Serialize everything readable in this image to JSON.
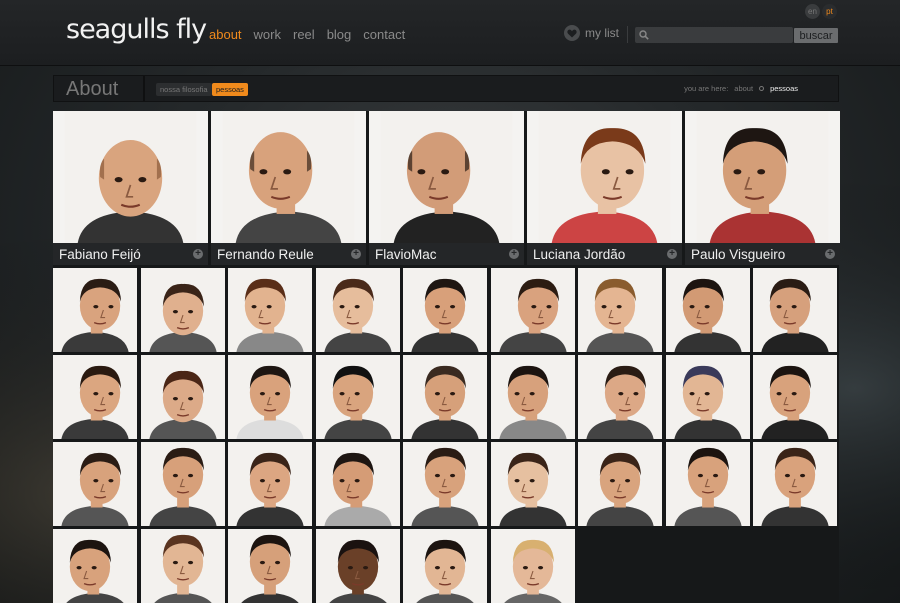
{
  "brand": {
    "logo": "seagulls fly"
  },
  "nav": {
    "items": [
      "about",
      "work",
      "reel",
      "blog",
      "contact"
    ],
    "active": "about"
  },
  "mylist": {
    "label": "my list",
    "icon": "heart-icon"
  },
  "search": {
    "placeholder": "",
    "button_label": "buscar"
  },
  "languages": {
    "en": "en",
    "pt": "pt",
    "active": "pt"
  },
  "about": {
    "title": "About",
    "subtabs": [
      "nossa filosofia",
      "pessoas"
    ],
    "active_subtab": "pessoas",
    "breadcrumb": {
      "prefix": "you are here:",
      "items": [
        "about",
        "pessoas"
      ]
    }
  },
  "featured": [
    {
      "name": "Fabiano Feijó"
    },
    {
      "name": "Fernando Reule"
    },
    {
      "name": "FlavioMac"
    },
    {
      "name": "Luciana Jordão"
    },
    {
      "name": "Paulo Visgueiro"
    }
  ],
  "thumbnails": [
    {
      "skin": "#d9a37e",
      "hair": "#2a1c14",
      "shirt": "#3a3a3a",
      "pose": "right"
    },
    {
      "skin": "#e0b08e",
      "hair": "#3a2418",
      "shirt": "#555",
      "pose": "down"
    },
    {
      "skin": "#e2b38f",
      "hair": "#5a2e18",
      "shirt": "#888",
      "pose": "left"
    },
    {
      "skin": "#e6bd9c",
      "hair": "#4a2a1a",
      "shirt": "#444",
      "pose": "left"
    },
    {
      "skin": "#d8a07a",
      "hair": "#1e1612",
      "shirt": "#333",
      "pose": "front"
    },
    {
      "skin": "#d9a27e",
      "hair": "#2c1c12",
      "shirt": "#444",
      "pose": "right"
    },
    {
      "skin": "#e4b592",
      "hair": "#8a5c2e",
      "shirt": "#555",
      "pose": "left"
    },
    {
      "skin": "#d29a74",
      "hair": "#1c1410",
      "shirt": "#333",
      "pose": "left"
    },
    {
      "skin": "#d6a07c",
      "hair": "#2a1c14",
      "shirt": "#222",
      "pose": "left"
    },
    {
      "skin": "#dba680",
      "hair": "#2a1a10",
      "shirt": "#3a3a3a",
      "pose": "right"
    },
    {
      "skin": "#dcaa88",
      "hair": "#4a2616",
      "shirt": "#555",
      "pose": "down"
    },
    {
      "skin": "#d9a27c",
      "hair": "#1e1612",
      "shirt": "#ddd",
      "pose": "front"
    },
    {
      "skin": "#d9a47e",
      "hair": "#111111",
      "shirt": "#444",
      "pose": "left"
    },
    {
      "skin": "#d6a07a",
      "hair": "#3a2a20",
      "shirt": "#333",
      "pose": "front"
    },
    {
      "skin": "#d7a17c",
      "hair": "#1c1410",
      "shirt": "#888",
      "pose": "left"
    },
    {
      "skin": "#dca886",
      "hair": "#2a1c14",
      "shirt": "#444",
      "pose": "right"
    },
    {
      "skin": "#e2b694",
      "hair": "#3a3a5a",
      "shirt": "#333",
      "pose": "left"
    },
    {
      "skin": "#d8a27c",
      "hair": "#1c1410",
      "shirt": "#222",
      "pose": "left"
    },
    {
      "skin": "#d8a27c",
      "hair": "#2a1c14",
      "shirt": "#555",
      "pose": "right"
    },
    {
      "skin": "#d7a07a",
      "hair": "#2a1c14",
      "shirt": "#444",
      "pose": "up"
    },
    {
      "skin": "#dca682",
      "hair": "#3a2418",
      "shirt": "#333",
      "pose": "front"
    },
    {
      "skin": "#d59c76",
      "hair": "#1e1612",
      "shirt": "#aaa",
      "pose": "left"
    },
    {
      "skin": "#d8a27c",
      "hair": "#2a1c14",
      "shirt": "#555",
      "pose": "up"
    },
    {
      "skin": "#e6c0a0",
      "hair": "#3a2418",
      "shirt": "#333",
      "pose": "left"
    },
    {
      "skin": "#d9a47e",
      "hair": "#3a2418",
      "shirt": "#444",
      "pose": "front"
    },
    {
      "skin": "#d8a27c",
      "hair": "#1c1410",
      "shirt": "#555",
      "pose": "up"
    },
    {
      "skin": "#d9a27c",
      "hair": "#3a2418",
      "shirt": "#333",
      "pose": "up"
    },
    {
      "skin": "#d8a27c",
      "hair": "#1c1410",
      "shirt": "#444",
      "pose": "left"
    },
    {
      "skin": "#e2b694",
      "hair": "#5a3420",
      "shirt": "#555",
      "pose": "up"
    },
    {
      "skin": "#d6a07a",
      "hair": "#1c1410",
      "shirt": "#333",
      "pose": "up"
    },
    {
      "skin": "#6a4028",
      "hair": "#1a1210",
      "shirt": "#444",
      "pose": "front"
    },
    {
      "skin": "#e2b694",
      "hair": "#1c1410",
      "shirt": "#555",
      "pose": "front"
    },
    {
      "skin": "#e4b898",
      "hair": "#d8b070",
      "shirt": "#666",
      "pose": "front"
    }
  ]
}
